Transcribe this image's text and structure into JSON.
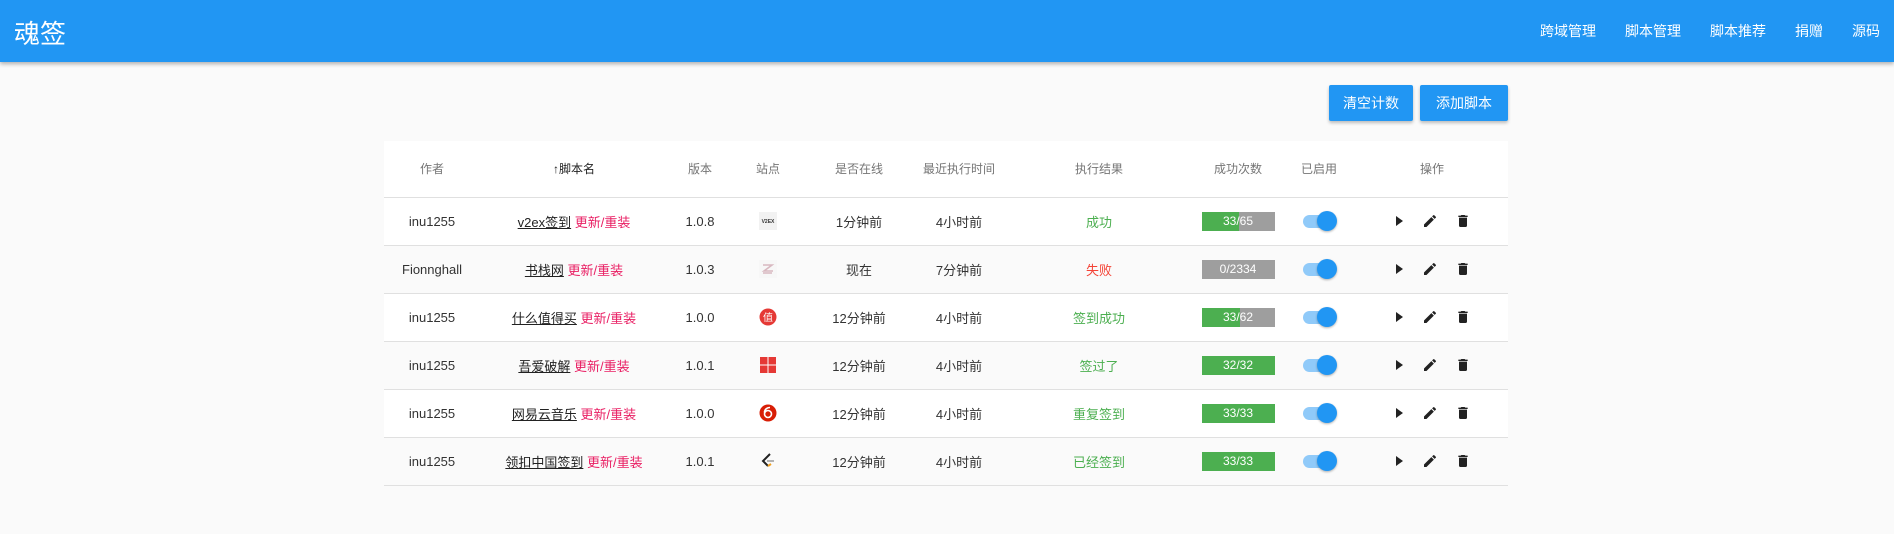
{
  "app": {
    "title": "魂签"
  },
  "nav": [
    "跨域管理",
    "脚本管理",
    "脚本推荐",
    "捐赠",
    "源码"
  ],
  "buttons": {
    "clear": "清空计数",
    "add": "添加脚本"
  },
  "columns": [
    "作者",
    "脚本名",
    "版本",
    "站点",
    "是否在线",
    "最近执行时间",
    "执行结果",
    "成功次数",
    "已启用",
    "操作"
  ],
  "sort_arrow": "↑",
  "update_label": "更新/重装",
  "colors": {
    "primary": "#2196f3",
    "success": "#4caf50",
    "fail": "#f44336",
    "update": "#e91e63"
  },
  "rows": [
    {
      "author": "inu1255",
      "name": "v2ex签到",
      "version": "1.0.8",
      "site_icon": "v2ex-icon",
      "online": "1分钟前",
      "last_run": "4小时前",
      "result": "成功",
      "result_status": "ok",
      "success": 33,
      "total": 65,
      "count": "33/65",
      "enabled": true
    },
    {
      "author": "Fionnghall",
      "name": "书栈网",
      "version": "1.0.3",
      "site_icon": "bookstack-icon",
      "online": "现在",
      "last_run": "7分钟前",
      "result": "失败",
      "result_status": "fail",
      "success": 0,
      "total": 2334,
      "count": "0/2334",
      "enabled": true
    },
    {
      "author": "inu1255",
      "name": "什么值得买",
      "version": "1.0.0",
      "site_icon": "smzdm-icon",
      "online": "12分钟前",
      "last_run": "4小时前",
      "result": "签到成功",
      "result_status": "ok",
      "success": 33,
      "total": 62,
      "count": "33/62",
      "enabled": true
    },
    {
      "author": "inu1255",
      "name": "吾爱破解",
      "version": "1.0.1",
      "site_icon": "52pojie-icon",
      "online": "12分钟前",
      "last_run": "4小时前",
      "result": "签过了",
      "result_status": "ok",
      "success": 32,
      "total": 32,
      "count": "32/32",
      "enabled": true
    },
    {
      "author": "inu1255",
      "name": "网易云音乐",
      "version": "1.0.0",
      "site_icon": "netease-music-icon",
      "online": "12分钟前",
      "last_run": "4小时前",
      "result": "重复签到",
      "result_status": "ok",
      "success": 33,
      "total": 33,
      "count": "33/33",
      "enabled": true
    },
    {
      "author": "inu1255",
      "name": "领扣中国签到",
      "version": "1.0.1",
      "site_icon": "leetcode-icon",
      "online": "12分钟前",
      "last_run": "4小时前",
      "result": "已经签到",
      "result_status": "ok",
      "success": 33,
      "total": 33,
      "count": "33/33",
      "enabled": true
    }
  ]
}
